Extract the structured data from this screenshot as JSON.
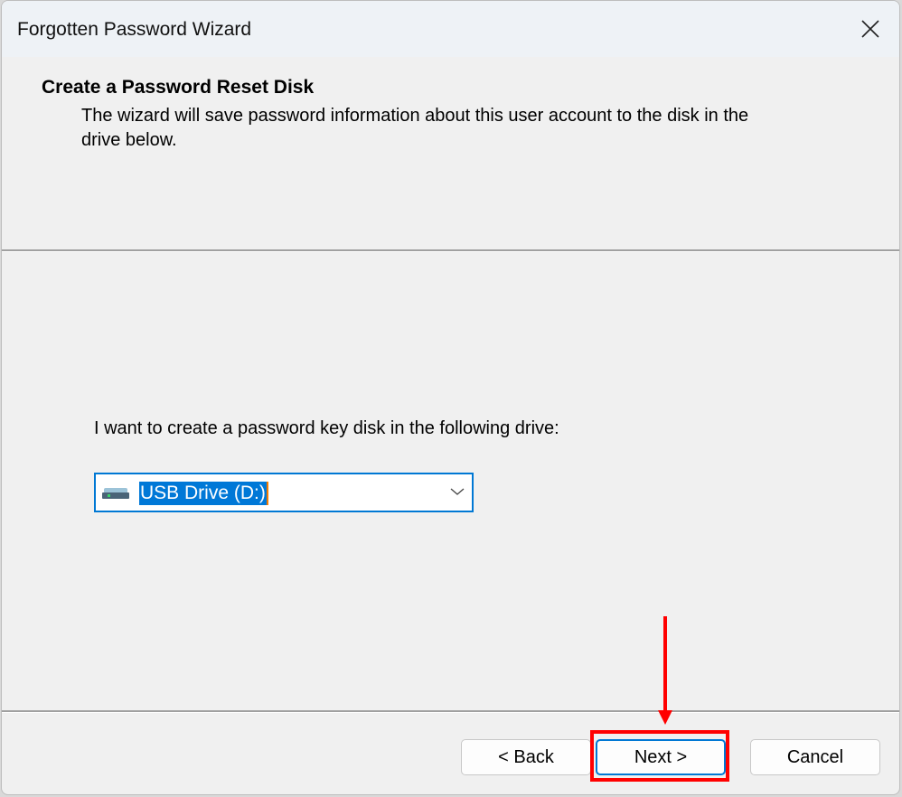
{
  "window": {
    "title": "Forgotten Password Wizard",
    "close_icon": "close-icon"
  },
  "header": {
    "title": "Create a Password Reset Disk",
    "description": "The wizard will save password information about this user account to the disk in the drive below."
  },
  "body": {
    "drive_label": "I want to create a password key disk in the following drive:",
    "drive_select": {
      "value": "USB Drive (D:)",
      "icon": "usb-drive-icon"
    }
  },
  "footer": {
    "back_label": "< Back",
    "next_label": "Next >",
    "cancel_label": "Cancel"
  },
  "annotation": {
    "color": "#ff0000",
    "target": "Next >"
  }
}
